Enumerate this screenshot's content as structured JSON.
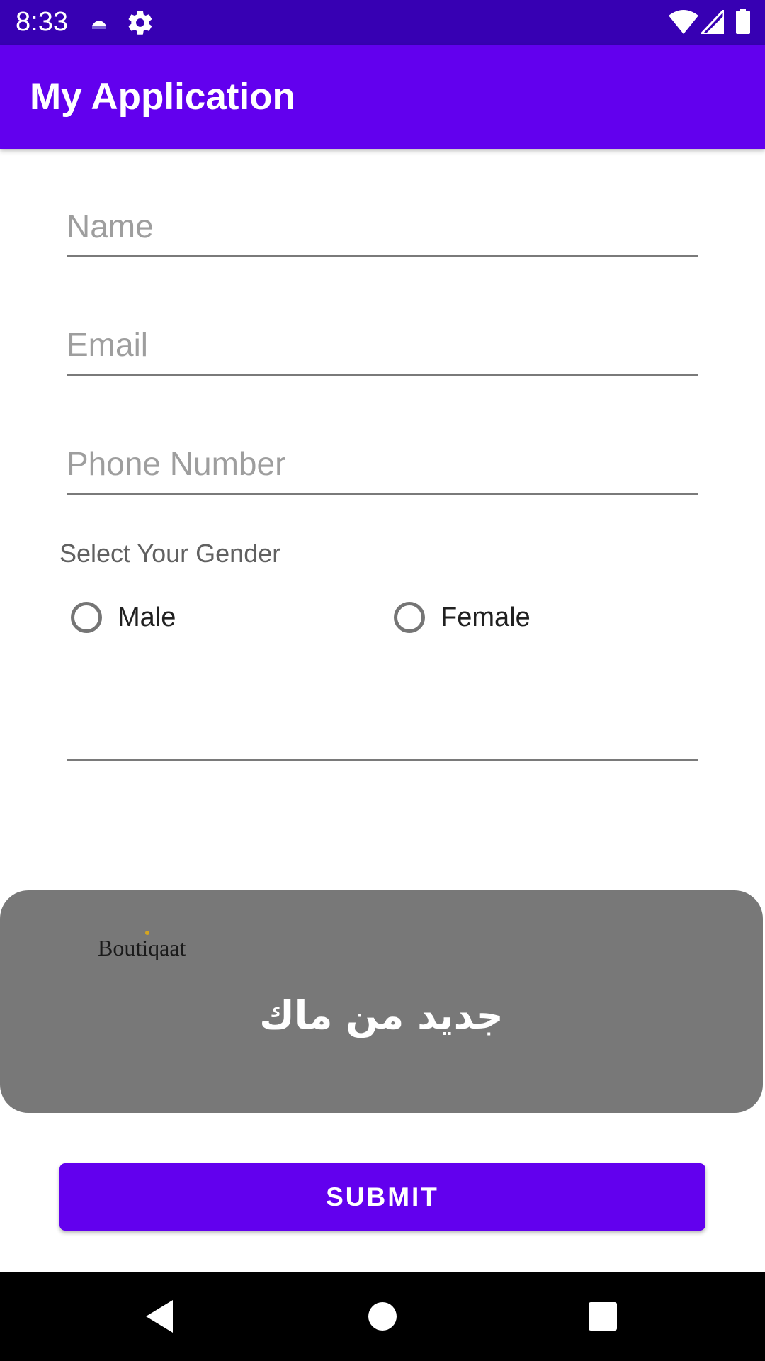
{
  "status_bar": {
    "time": "8:33",
    "icons": [
      "notification-icon",
      "settings-gear-icon",
      "wifi-icon",
      "cell-signal-icon",
      "battery-icon"
    ]
  },
  "app_bar": {
    "title": "My Application"
  },
  "form": {
    "name_placeholder": "Name",
    "email_placeholder": "Email",
    "phone_placeholder": "Phone Number",
    "extra_value": "",
    "gender_label": "Select Your Gender",
    "gender_options": [
      "Male",
      "Female"
    ],
    "selected_gender": null
  },
  "toast": {
    "logo_text": "Boutiqaat",
    "message": "جديد من ماك"
  },
  "submit_label": "SUBMIT",
  "nav_bar": {
    "icons": [
      "back-icon",
      "home-icon",
      "recents-icon"
    ]
  },
  "colors": {
    "status_bar": "#3700b3",
    "primary": "#6200ee",
    "toast_background": "#787878"
  }
}
